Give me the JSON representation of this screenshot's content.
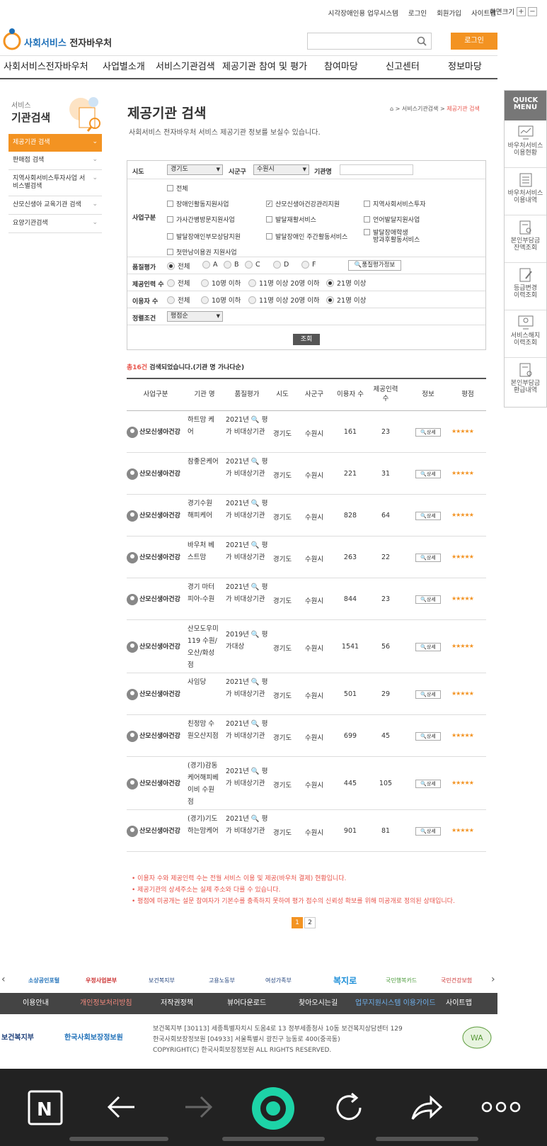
{
  "top_links": [
    "시각장애인용 업무시스템",
    "로그인",
    "회원가입",
    "사이트맵"
  ],
  "font_size": {
    "label": "화면크기",
    "plus": "+",
    "minus": "−"
  },
  "logo": {
    "prefix": "사회서비스",
    "suffix": "전자바우처"
  },
  "search": {
    "placeholder": ""
  },
  "login_button": "로그인",
  "gnb": [
    "사회서비스전자바우처",
    "사업별소개",
    "서비스기관검색",
    "제공기관 참여 및 평가",
    "참여마당",
    "신고센터",
    "정보마당"
  ],
  "quick": {
    "title1": "QUICK",
    "title2": "MENU",
    "items": [
      [
        "바우처서비스",
        "이용현황"
      ],
      [
        "바우처서비스",
        "이용내역"
      ],
      [
        "본인부담금",
        "잔액조회"
      ],
      [
        "등급변경",
        "이력조회"
      ],
      [
        "서비스해지",
        "이력조회"
      ],
      [
        "본인부담금",
        "환급내역"
      ]
    ]
  },
  "lnb": {
    "title_small": "서비스",
    "title_big": "기관검색",
    "items": [
      "제공기관 검색",
      "판매점 검색",
      "지역사회서비스투자사업 서비스별검색",
      "산모신생아 교육기관 검색",
      "요양기관검색"
    ]
  },
  "page": {
    "title": "제공기관 검색",
    "desc": "사회서비스 전자바우처 서비스 제공기관 정보를 보실수 있습니다.",
    "breadcrumb_home": "⌂",
    "breadcrumb_1": "서비스기관검색",
    "breadcrumb_2": "제공기관 검색"
  },
  "form": {
    "sido_label": "시도",
    "sido_value": "경기도",
    "sigungu_label": "시군구",
    "sigungu_value": "수원시",
    "name_label": "기관명",
    "biz_label": "사업구분",
    "biz_items": [
      {
        "label": "전체",
        "checked": false
      },
      {
        "label": "장애인활동지원사업",
        "checked": false
      },
      {
        "label": "산모신생아건강관리지원",
        "checked": true
      },
      {
        "label": "지역사회서비스투자",
        "checked": false
      },
      {
        "label": "가사간병방문지원사업",
        "checked": false
      },
      {
        "label": "발달재활서비스",
        "checked": false
      },
      {
        "label": "언어발달지원사업",
        "checked": false
      },
      {
        "label": "발달장애인부모상담지원",
        "checked": false
      },
      {
        "label": "발달장애인 주간활동서비스",
        "checked": false
      },
      {
        "label": "발달장애학생",
        "checked": false
      },
      {
        "label": "방과후활동서비스",
        "checked": false
      },
      {
        "label": "첫만남이용권 지원사업",
        "checked": false
      }
    ],
    "quality_label": "품질평가",
    "quality_opts": [
      "전체",
      "A",
      "B",
      "C",
      "D",
      "F"
    ],
    "quality_sel": 0,
    "quality_btn": "품질평가정보",
    "staff_label": "제공인력 수",
    "staff_opts": [
      "전체",
      "10명 이하",
      "11명 이상 20명 이하",
      "21명 이상"
    ],
    "staff_sel": 3,
    "users_label": "이용자 수",
    "users_opts": [
      "전체",
      "10명 이하",
      "11명 이상 20명 이하",
      "21명 이상"
    ],
    "users_sel": 3,
    "sort_label": "정렬조건",
    "sort_value": "평점순",
    "search_btn": "조회"
  },
  "result": {
    "count": "총16건",
    "text": "검색되었습니다.(기관 명 가나다순)"
  },
  "table": {
    "headers": [
      "사업구분",
      "기관 명",
      "품질평가",
      "시도",
      "사군구",
      "이용자 수",
      "제공인력 수",
      "정보",
      "평점"
    ],
    "rows": [
      {
        "cat": "산모신생아건강",
        "name": "하트맘 케어",
        "eval": "2021년 🔍 평가 비대상기관",
        "sido": "경기도",
        "sgg": "수원시",
        "users": "161",
        "staff": "23",
        "info": "상세",
        "rating": 5
      },
      {
        "cat": "산모신생아건강",
        "name": "참좋은케어",
        "eval": "2021년 🔍 평가 비대상기관",
        "sido": "경기도",
        "sgg": "수원시",
        "users": "221",
        "staff": "31",
        "info": "상세",
        "rating": 5
      },
      {
        "cat": "산모신생아건강",
        "name": "경기수원 해피케어",
        "eval": "2021년 🔍 평가 비대상기관",
        "sido": "경기도",
        "sgg": "수원시",
        "users": "828",
        "staff": "64",
        "info": "상세",
        "rating": 5
      },
      {
        "cat": "산모신생아건강",
        "name": "바우처 베스트맘",
        "eval": "2021년 🔍 평가 비대상기관",
        "sido": "경기도",
        "sgg": "수원시",
        "users": "263",
        "staff": "22",
        "info": "상세",
        "rating": 5
      },
      {
        "cat": "산모신생아건강",
        "name": "경기 마터피아-수원",
        "eval": "2021년 🔍 평가 비대상기관",
        "sido": "경기도",
        "sgg": "수원시",
        "users": "844",
        "staff": "23",
        "info": "상세",
        "rating": 5
      },
      {
        "cat": "산모신생아건강",
        "name": "산모도우미119 수원/오산/화성점",
        "eval": "2019년 🔍 평가대상",
        "sido": "경기도",
        "sgg": "수원시",
        "users": "1541",
        "staff": "56",
        "info": "상세",
        "rating": 5
      },
      {
        "cat": "산모신생아건강",
        "name": "사임당",
        "eval": "2021년 🔍 평가 비대상기관",
        "sido": "경기도",
        "sgg": "수원시",
        "users": "501",
        "staff": "29",
        "info": "상세",
        "rating": 5
      },
      {
        "cat": "산모신생아건강",
        "name": "친정맘 수원오산지점",
        "eval": "2021년 🔍 평가 비대상기관",
        "sido": "경기도",
        "sgg": "수원시",
        "users": "699",
        "staff": "45",
        "info": "상세",
        "rating": 5
      },
      {
        "cat": "산모신생아건강",
        "name": "(경기)감동케어해피베이비 수원점",
        "eval": "2021년 🔍 평가 비대상기관",
        "sido": "경기도",
        "sgg": "수원시",
        "users": "445",
        "staff": "105",
        "info": "상세",
        "rating": 5
      },
      {
        "cat": "산모신생아건강",
        "name": "(경기)기도하는맘케어",
        "eval": "2021년 🔍 평가 비대상기관",
        "sido": "경기도",
        "sgg": "수원시",
        "users": "901",
        "staff": "81",
        "info": "상세",
        "rating": 5
      }
    ]
  },
  "notes": [
    "• 이용자 수와 제공인력 수는 전월 서비스 이용 및 제공(바우처 결제) 현황입니다.",
    "• 제공기관의 상세주소는 실제 주소와 다를 수 있습니다.",
    "• 평점에 미공개는 설문 참여자가 기본수를 충족하지 못하여 평가 점수의 신뢰성 확보를 위해 미공개로 정의된 상태입니다."
  ],
  "pager": [
    "1",
    "2"
  ],
  "banners": [
    "소상공인포털",
    "우정사업본부",
    "보건복지부",
    "고용노동부",
    "여성가족부",
    "복지로",
    "국민행복카드",
    "국민건강보험"
  ],
  "footer_nav": [
    "이용안내",
    "개인정보처리방침",
    "저작권정책",
    "뷰어다운로드",
    "찾아오시는길",
    "업무지원시스템 이용가이드",
    "사이트맵"
  ],
  "footer": {
    "org1": "보건복지부",
    "org2": "한국사회보장정보원",
    "addr1": "보건복지부 [30113] 세종특별자치시 도움4로 13 정부세종청사 10동 보건복지상담센터 129",
    "addr2": "한국사회보장정보원 [04933] 서울특별시 광진구 능동로 400(중곡동)",
    "copy": "COPYRIGHT(C) 한국사회보장정보원 ALL RIGHTS RESERVED."
  },
  "colors": {
    "accent": "#f39322",
    "brand": "#1d6fb8",
    "alert": "#e8534a"
  }
}
